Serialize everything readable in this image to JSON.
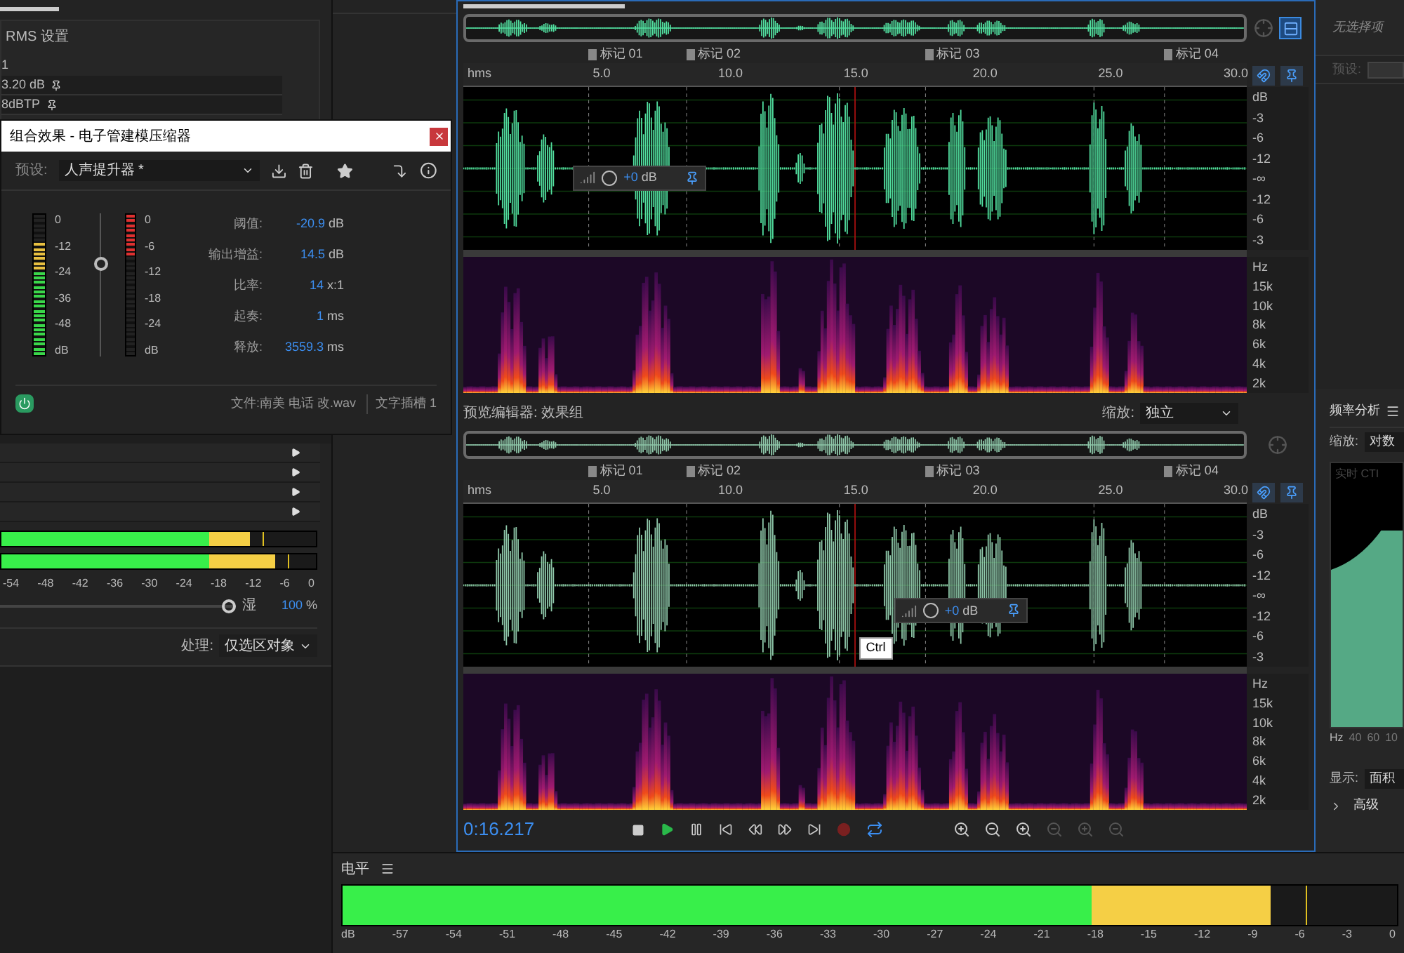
{
  "left_panel": {
    "title": "RMS 设置",
    "rows": [
      "1",
      "3.20 dB",
      "8dBTP"
    ]
  },
  "effect_dialog": {
    "title": "组合效果 - 电子管建模压缩器",
    "preset_label": "预设:",
    "preset_value": "人声提升器 *",
    "input_meter": {
      "level": 0.8,
      "scale": [
        "0",
        "-12",
        "-24",
        "-36",
        "-48",
        "dB"
      ]
    },
    "threshold_slider": {
      "level": 0.65
    },
    "reduction_meter": {
      "level": 0.27,
      "scale": [
        "0",
        "-6",
        "-12",
        "-18",
        "-24",
        "dB"
      ]
    },
    "params": [
      {
        "label": "阈值:",
        "value": "-20.9",
        "unit": "dB"
      },
      {
        "label": "输出增益:",
        "value": "14.5",
        "unit": "dB"
      },
      {
        "label": "比率:",
        "value": "14",
        "unit": "x:1"
      },
      {
        "label": "起奏:",
        "value": "1",
        "unit": "ms"
      },
      {
        "label": "释放:",
        "value": "3559.3",
        "unit": "ms"
      }
    ],
    "power_on": true,
    "file_info": "文件:南美 电话  改.wav",
    "slot": "文字插槽 1"
  },
  "rack_slots": [
    {
      "expanded": false
    },
    {
      "expanded": false
    },
    {
      "expanded": false
    },
    {
      "expanded": false
    }
  ],
  "mix_meters": [
    {
      "level": 0.79
    },
    {
      "level": 0.87
    }
  ],
  "mix_scale": [
    "-54",
    "-48",
    "-42",
    "-36",
    "-30",
    "-24",
    "-18",
    "-12",
    "-6",
    "0"
  ],
  "mix": {
    "label": "湿",
    "value": "100",
    "unit": "%",
    "level": 1
  },
  "process": {
    "label": "处理:",
    "value": "仅选区对象"
  },
  "editor": {
    "active": true,
    "markers": [
      "标记 01",
      "标记 02",
      "标记 03",
      "标记 04"
    ],
    "ruler": [
      "hms",
      "5.0",
      "10.0",
      "15.0",
      "20.0",
      "25.0",
      "30.0"
    ],
    "db_scale": [
      "dB",
      "-3",
      "-6",
      "-12",
      "-∞",
      "-12",
      "-6",
      "-3"
    ],
    "hz_scale": [
      "Hz",
      "15k",
      "10k",
      "8k",
      "6k",
      "4k",
      "2k"
    ],
    "hud": {
      "value": "+0",
      "unit": "dB"
    }
  },
  "preview_bar": {
    "label": "预览编辑器: 效果组",
    "zoom_label": "缩放:",
    "zoom_value": "独立"
  },
  "preview_editor": {
    "active": false,
    "markers": [
      "标记 01",
      "标记 02",
      "标记 03",
      "标记 04"
    ],
    "ruler": [
      "hms",
      "5.0",
      "10.0",
      "15.0",
      "20.0",
      "25.0",
      "30.0"
    ],
    "db_scale": [
      "dB",
      "-3",
      "-6",
      "-12",
      "-∞",
      "-12",
      "-6",
      "-3"
    ],
    "hz_scale": [
      "Hz",
      "15k",
      "10k",
      "8k",
      "6k",
      "4k",
      "2k"
    ],
    "hud": {
      "value": "+0",
      "unit": "dB"
    },
    "tooltip": "Ctrl"
  },
  "transport": {
    "time": "0:16.217",
    "loop": true
  },
  "right_panel": {
    "title": "无选择项",
    "preset_label": "预设:",
    "analysis_title": "频率分析",
    "zoom_label": "缩放:",
    "zoom_value": "对数",
    "chart_label": "实时 CTI",
    "axis": [
      "Hz",
      "40",
      "60",
      "10"
    ],
    "display_label": "显示:",
    "display_value": "面积",
    "advanced": "高级"
  },
  "level_panel": {
    "title": "电平",
    "level": 0.88,
    "scale": [
      "dB",
      "-57",
      "-54",
      "-51",
      "-48",
      "-45",
      "-42",
      "-39",
      "-36",
      "-33",
      "-30",
      "-27",
      "-24",
      "-21",
      "-18",
      "-15",
      "-12",
      "-9",
      "-6",
      "-3",
      "0"
    ]
  }
}
